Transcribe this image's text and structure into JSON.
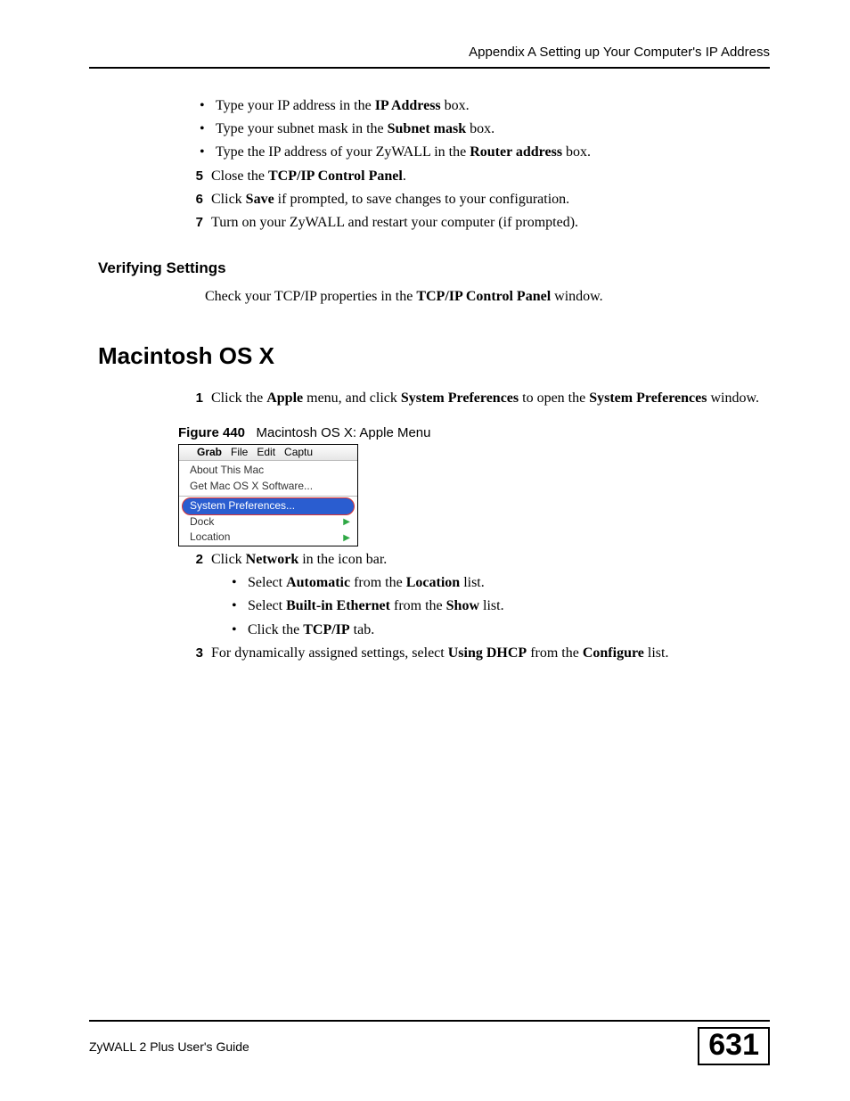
{
  "header": "Appendix A Setting up Your Computer's IP Address",
  "top_bullets": {
    "b1": {
      "pre": "Type your IP address in the ",
      "bold": "IP Address",
      "post": " box."
    },
    "b2": {
      "pre": "Type your subnet mask in the ",
      "bold": "Subnet mask",
      "post": " box."
    },
    "b3": {
      "pre": "Type the IP address of your ZyWALL in the ",
      "bold": "Router address",
      "post": " box."
    }
  },
  "steps_top": {
    "s5": {
      "n": "5",
      "pre": "Close the ",
      "bold": "TCP/IP Control Panel",
      "post": "."
    },
    "s6": {
      "n": "6",
      "pre": "Click ",
      "bold": "Save",
      "post": " if prompted, to save changes to your configuration."
    },
    "s7": {
      "n": "7",
      "text": "Turn on your ZyWALL and restart your computer (if prompted)."
    }
  },
  "verify_heading": "Verifying Settings",
  "verify_para": {
    "pre": "Check your TCP/IP properties in the ",
    "bold": "TCP/IP Control Panel",
    "post": " window."
  },
  "macosx_heading": "Macintosh OS X",
  "mac_step1": {
    "n": "1",
    "pre": "Click the ",
    "b1": "Apple",
    "mid1": " menu, and click ",
    "b2": "System Preferences",
    "mid2": " to open the ",
    "b3": "System Preferences",
    "post": " window."
  },
  "figure": {
    "label": "Figure 440",
    "caption": "Macintosh OS X: Apple Menu",
    "menubar": [
      "Grab",
      "File",
      "Edit",
      "Captu"
    ],
    "items": {
      "about": "About This Mac",
      "getsw": "Get Mac OS X Software...",
      "sysprefs": "System Preferences...",
      "dock": "Dock",
      "location": "Location"
    }
  },
  "mac_step2": {
    "n": "2",
    "pre": "Click ",
    "bold": "Network",
    "post": " in the icon bar.",
    "sub1": {
      "pre": "Select ",
      "b1": "Automatic",
      "mid": " from the ",
      "b2": "Location",
      "post": " list."
    },
    "sub2": {
      "pre": "Select ",
      "b1": "Built-in Ethernet",
      "mid": " from the ",
      "b2": "Show",
      "post": " list."
    },
    "sub3": {
      "pre": "Click the ",
      "b1": "TCP/IP",
      "post": " tab."
    }
  },
  "mac_step3": {
    "n": "3",
    "pre": "For dynamically assigned settings, select ",
    "b1": "Using DHCP",
    "mid": " from the ",
    "b2": "Configure",
    "post": " list."
  },
  "footer": {
    "guide": "ZyWALL 2 Plus User's Guide",
    "page": "631"
  }
}
